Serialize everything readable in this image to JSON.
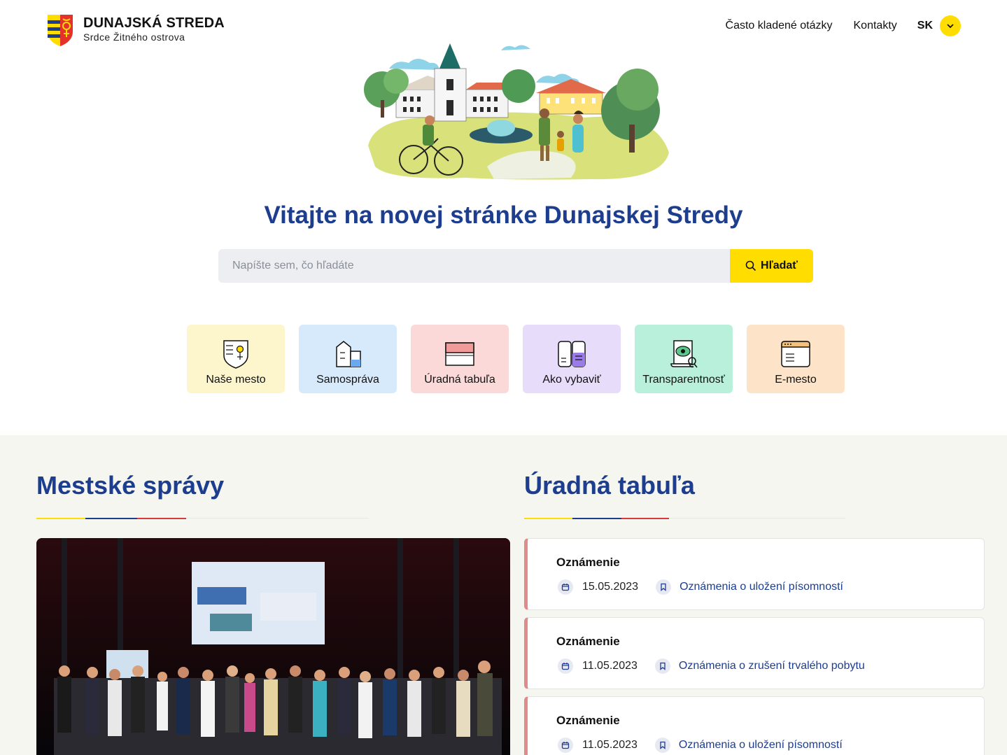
{
  "header": {
    "logo_title": "DUNAJSKÁ STREDA",
    "logo_subtitle": "Srdce Žitného ostrova",
    "nav": [
      {
        "label": "Často kladené otázky"
      },
      {
        "label": "Kontakty"
      }
    ],
    "language": "SK"
  },
  "hero": {
    "title": "Vitajte na novej stránke Dunajskej Stredy",
    "search_placeholder": "Napíšte sem, čo hľadáte",
    "search_button": "Hľadať"
  },
  "tiles": [
    {
      "label": "Naše mesto",
      "icon": "city-crest-icon",
      "color": "#fdf6cc"
    },
    {
      "label": "Samospráva",
      "icon": "building-icon",
      "color": "#d7eafc"
    },
    {
      "label": "Úradná tabuľa",
      "icon": "notice-board-icon",
      "color": "#fbd9d9"
    },
    {
      "label": "Ako vybaviť",
      "icon": "book-icon",
      "color": "#e8dcfb"
    },
    {
      "label": "Transparentnosť",
      "icon": "document-eye-icon",
      "color": "#b8f0dc"
    },
    {
      "label": "E-mesto",
      "icon": "browser-window-icon",
      "color": "#fde4c8"
    }
  ],
  "news": {
    "title": "Mestské správy",
    "image": "award-ceremony-photo"
  },
  "board": {
    "title": "Úradná tabuľa",
    "notices": [
      {
        "title": "Oznámenie",
        "date": "15.05.2023",
        "category": "Oznámenia o uložení písomností"
      },
      {
        "title": "Oznámenie",
        "date": "11.05.2023",
        "category": "Oznámenia o zrušení trvalého pobytu"
      },
      {
        "title": "Oznámenie",
        "date": "11.05.2023",
        "category": "Oznámenia o uložení písomností"
      }
    ]
  },
  "colors": {
    "brand_blue": "#1d3d8f",
    "brand_yellow": "#ffdd00",
    "brand_red": "#d63a3a"
  }
}
